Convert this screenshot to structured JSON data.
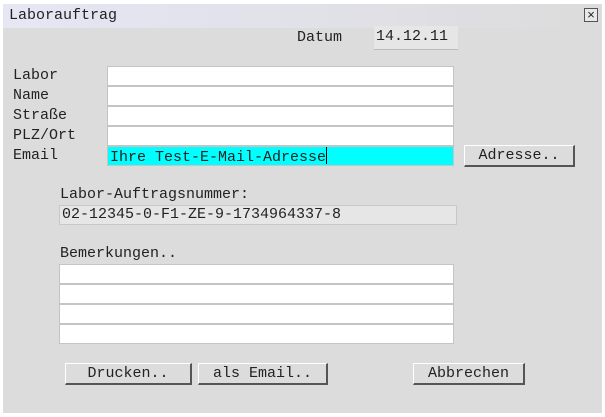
{
  "window": {
    "title": "Laborauftrag",
    "close_label": "×"
  },
  "date": {
    "label": "Datum",
    "value": "14.12.11"
  },
  "address": {
    "labels": [
      "Labor",
      "Name",
      "Straße",
      "PLZ/Ort",
      "Email"
    ],
    "values": [
      "",
      "",
      "",
      "",
      "Ihre Test-E-Mail-Adresse"
    ]
  },
  "buttons": {
    "address": "Adresse..",
    "print": "Drucken..",
    "email": "als Email..",
    "cancel": "Abbrechen"
  },
  "order": {
    "label": "Labor-Auftragsnummer:",
    "number": "02-12345-0-F1-ZE-9-1734964337-8"
  },
  "remarks": {
    "label": "Bemerkungen..",
    "lines": [
      "",
      "",
      "",
      ""
    ]
  }
}
